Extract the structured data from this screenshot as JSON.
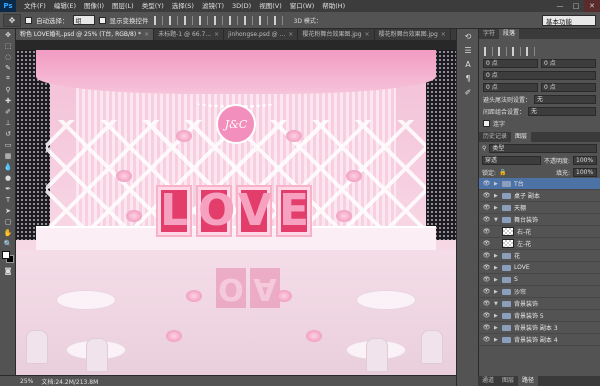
{
  "app": {
    "logo": "Ps"
  },
  "menu": [
    "文件(F)",
    "编辑(E)",
    "图像(I)",
    "图层(L)",
    "类型(Y)",
    "选择(S)",
    "滤镜(T)",
    "3D(D)",
    "视图(V)",
    "窗口(W)",
    "帮助(H)"
  ],
  "window_controls": [
    "—",
    "□",
    "✕"
  ],
  "options": {
    "auto_select_label": "自动选择：",
    "auto_select_value": "组",
    "show_transform_label": "显示变换控件",
    "mode_3d_label": "3D 模式：",
    "workspace": "基本功能"
  },
  "tabs": [
    {
      "label": "粉色 LOVE婚礼.psd @ 25% (T台, RGB/8) *",
      "active": true
    },
    {
      "label": "未标题-1 @ 66.7...",
      "active": false
    },
    {
      "label": "jinhongse.psd @ ...",
      "active": false
    },
    {
      "label": "樱花粉舞台效果图.jpg",
      "active": false
    },
    {
      "label": "樱花粉舞台效果图.jpg",
      "active": false
    }
  ],
  "canvas": {
    "monogram": "J&C",
    "love_letters": [
      "L",
      "O",
      "V",
      "E"
    ],
    "reflection_letters": [
      "O",
      "A"
    ]
  },
  "status": {
    "zoom": "25%",
    "doc_info": "文档:24.2M/213.8M"
  },
  "char_panel": {
    "tabs": [
      "字符",
      "段落"
    ],
    "field1": "0 点",
    "field2": "0 点",
    "field3": "0 点",
    "field4": "0 点",
    "indent_before_label": "避头尾法则设置：",
    "indent_before_value": "无",
    "spacing_label": "间距组合设置：",
    "spacing_value": "无",
    "hyphen_label": "连字"
  },
  "layers_panel": {
    "tabs": [
      "历史记录",
      "图层"
    ],
    "filter_value": "类型",
    "blend_mode": "穿透",
    "opacity_label": "不透明度:",
    "opacity_value": "100%",
    "lock_label": "锁定:",
    "fill_label": "填充:",
    "fill_value": "100%",
    "layers": [
      {
        "name": "T台",
        "type": "group",
        "selected": true
      },
      {
        "name": "桌子 副本",
        "type": "group",
        "selected": false
      },
      {
        "name": "天棚",
        "type": "group",
        "selected": false
      },
      {
        "name": "舞台装饰",
        "type": "group",
        "selected": false,
        "open": true
      },
      {
        "name": "右-花",
        "type": "layer",
        "selected": false
      },
      {
        "name": "左-花",
        "type": "layer",
        "selected": false
      },
      {
        "name": "花",
        "type": "group",
        "selected": false
      },
      {
        "name": "LOVE",
        "type": "group",
        "selected": false
      },
      {
        "name": "S",
        "type": "group",
        "selected": false
      },
      {
        "name": "沙帘",
        "type": "group",
        "selected": false
      },
      {
        "name": "背景装饰",
        "type": "group",
        "selected": false,
        "open": true
      },
      {
        "name": "背景装饰 5",
        "type": "group",
        "selected": false
      },
      {
        "name": "背景装饰 副本 3",
        "type": "group",
        "selected": false
      },
      {
        "name": "背景装饰 副本 4",
        "type": "group",
        "selected": false
      }
    ]
  },
  "bottom_tabs": [
    "通道",
    "图层",
    "路径"
  ]
}
